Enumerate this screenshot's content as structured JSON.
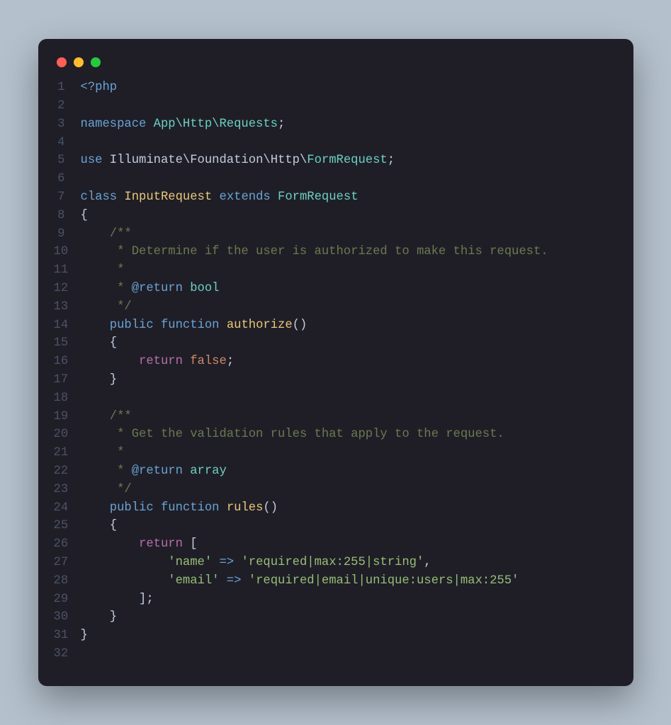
{
  "window": {
    "traffic_lights": {
      "red": "#ff5f56",
      "yellow": "#ffbd2e",
      "green": "#27c93f"
    }
  },
  "code": {
    "language": "php",
    "line_numbers": [
      "1",
      "2",
      "3",
      "4",
      "5",
      "6",
      "7",
      "8",
      "9",
      "10",
      "11",
      "12",
      "13",
      "14",
      "15",
      "16",
      "17",
      "18",
      "19",
      "20",
      "21",
      "22",
      "23",
      "24",
      "25",
      "26",
      "27",
      "28",
      "29",
      "30",
      "31",
      "32"
    ],
    "tokens": {
      "l1_open": "<?php",
      "l3_ns_kw": "namespace",
      "l3_ns_path": "App\\Http\\Requests",
      "l3_semi": ";",
      "l5_use_kw": "use",
      "l5_use_path": "Illuminate\\Foundation\\Http\\",
      "l5_use_class": "FormRequest",
      "l5_semi": ";",
      "l7_class_kw": "class",
      "l7_class_name": "InputRequest",
      "l7_extends_kw": "extends",
      "l7_parent": "FormRequest",
      "l8_open": "{",
      "l9_c": "    /**",
      "l10_c": "     * Determine if the user is authorized to make this request.",
      "l11_c": "     *",
      "l12_c_pre": "     * ",
      "l12_ann": "@return",
      "l12_sp": " ",
      "l12_type": "bool",
      "l13_c": "     */",
      "l14_pub": "public",
      "l14_fn": "function",
      "l14_name": "authorize",
      "l14_paren": "()",
      "l15_open": "    {",
      "l16_ret": "return",
      "l16_false": "false",
      "l16_semi": ";",
      "l17_close": "    }",
      "l19_c": "    /**",
      "l20_c": "     * Get the validation rules that apply to the request.",
      "l21_c": "     *",
      "l22_c_pre": "     * ",
      "l22_ann": "@return",
      "l22_sp": " ",
      "l22_type": "array",
      "l23_c": "     */",
      "l24_pub": "public",
      "l24_fn": "function",
      "l24_name": "rules",
      "l24_paren": "()",
      "l25_open": "    {",
      "l26_ret": "return",
      "l26_bracket": " [",
      "l27_key": "'name'",
      "l27_arrow": " => ",
      "l27_val": "'required|max:255|string'",
      "l27_comma": ",",
      "l28_key": "'email'",
      "l28_arrow": " => ",
      "l28_val": "'required|email|unique:users|max:255'",
      "l29_close_arr": "        ];",
      "l30_close": "    }",
      "l31_close": "}"
    }
  }
}
